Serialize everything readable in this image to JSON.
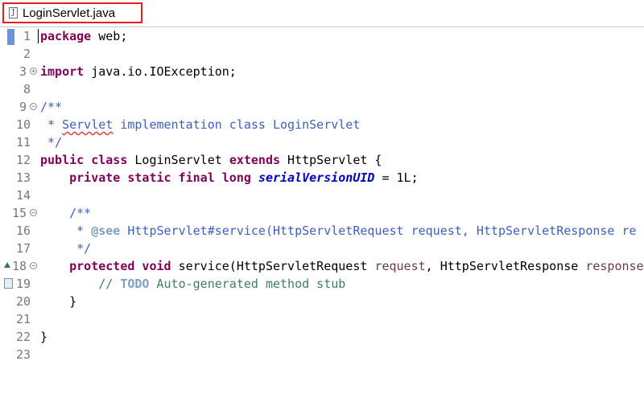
{
  "tab": {
    "label": "LoginServlet.java",
    "icon": "java-file-icon"
  },
  "colors": {
    "keyword": "#7f0055",
    "javadoc": "#3f5fbf",
    "comment": "#3f7f5f",
    "field": "#0000c0",
    "tab_highlight": "#e02020"
  },
  "lines": {
    "n1": "1",
    "n2": "2",
    "n3": "3",
    "n8": "8",
    "n9": "9",
    "n10": "10",
    "n11": "11",
    "n12": "12",
    "n13": "13",
    "n14": "14",
    "n15": "15",
    "n16": "16",
    "n17": "17",
    "n18": "18",
    "n19": "19",
    "n20": "20",
    "n21": "21",
    "n22": "22",
    "n23": "23"
  },
  "code": {
    "l1_kw": "package",
    "l1_rest": " web;",
    "l3_kw": "import",
    "l3_rest": " java.io.IOException;",
    "l9": "/**",
    "l10_a": " * ",
    "l10_spell": "Servlet",
    "l10_b": " implementation class LoginServlet",
    "l11": " */",
    "l12_kw1": "public",
    "l12_kw2": "class",
    "l12_name": " LoginServlet ",
    "l12_kw3": "extends",
    "l12_rest": " HttpServlet {",
    "l13_kw": "private static final long",
    "l13_field": "serialVersionUID",
    "l13_rest": " = 1L;",
    "l15": "/**",
    "l16_a": " * ",
    "l16_tag": "@see",
    "l16_b": " HttpServlet#service(HttpServletRequest request, HttpServletResponse re",
    "l17": " */",
    "l18_kw": "protected void",
    "l18_a": " service(HttpServletRequest ",
    "l18_p1": "request",
    "l18_b": ", HttpServletResponse ",
    "l18_p2": "response",
    "l19_a": "// ",
    "l19_todo": "TODO",
    "l19_b": " Auto-generated method stub",
    "l20": "}",
    "l22": "}"
  }
}
